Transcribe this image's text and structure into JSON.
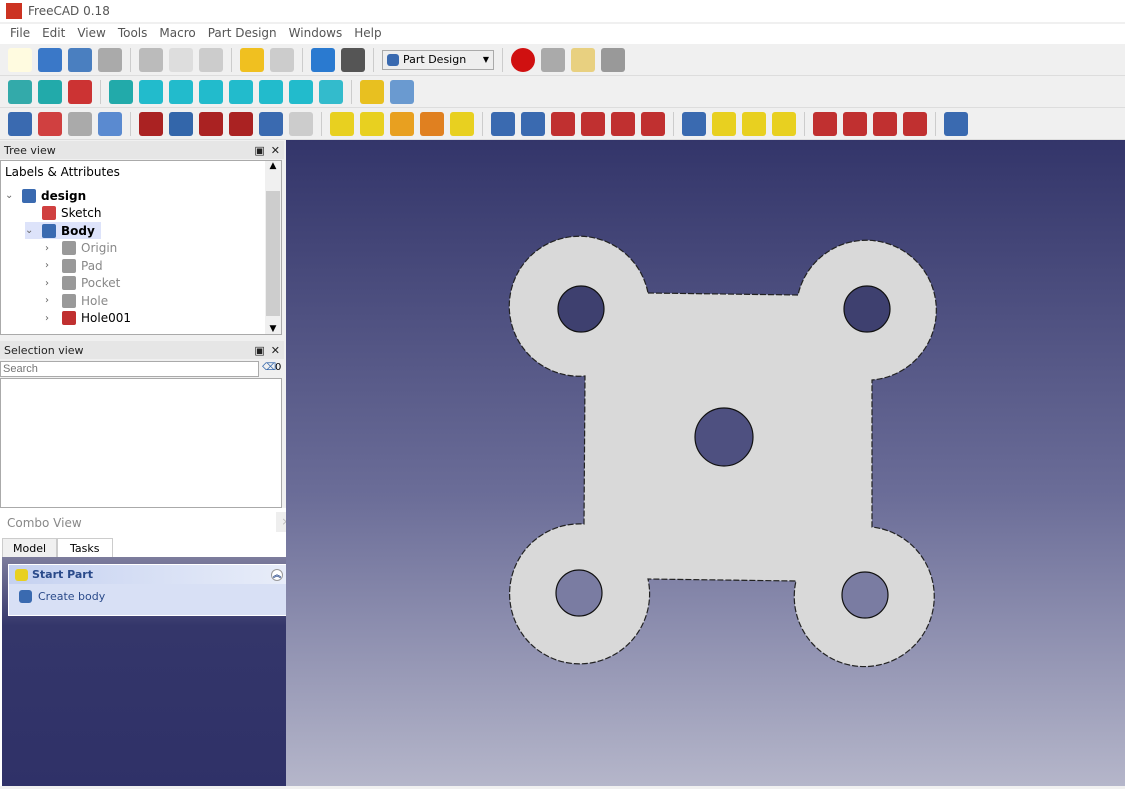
{
  "window": {
    "title": "FreeCAD 0.18",
    "logo": "Fc"
  },
  "menu": [
    "File",
    "Edit",
    "View",
    "Tools",
    "Macro",
    "Part Design",
    "Windows",
    "Help"
  ],
  "toolbar1": {
    "icons": [
      [
        "new-file-icon",
        "#fffbe0"
      ],
      [
        "open-icon",
        "#3a78c8"
      ],
      [
        "save-icon",
        "#4a7fc0"
      ],
      [
        "save-as-icon",
        "#aaa"
      ],
      "|",
      [
        "cut-icon",
        "#bbb"
      ],
      [
        "copy-icon",
        "#ddd"
      ],
      [
        "paste-icon",
        "#ccc"
      ],
      "|",
      [
        "undo-icon",
        "#f0c020"
      ],
      [
        "redo-icon",
        "#ccc"
      ],
      "|",
      [
        "refresh-icon",
        "#2a7ad0"
      ],
      [
        "whats-this-icon",
        "#555"
      ]
    ],
    "workbench": "Part Design",
    "macro_icons": [
      [
        "record-macro-icon",
        "#d01010"
      ],
      [
        "stop-macro-icon",
        "#aaa"
      ],
      [
        "edit-macro-icon",
        "#e8d080"
      ],
      [
        "run-macro-icon",
        "#999"
      ]
    ]
  },
  "toolbar2": {
    "icons": [
      [
        "fit-all-icon",
        "#3aa"
      ],
      [
        "fit-selection-icon",
        "#2aa"
      ],
      [
        "draw-style-icon",
        "#c33"
      ],
      "|",
      [
        "isometric-view-icon",
        "#2aa"
      ],
      [
        "front-view-icon",
        "#2bc"
      ],
      [
        "top-view-icon",
        "#2bc"
      ],
      [
        "right-view-icon",
        "#2bc"
      ],
      [
        "rear-view-icon",
        "#2bc"
      ],
      [
        "bottom-view-icon",
        "#2bc"
      ],
      [
        "left-view-icon",
        "#2bc"
      ],
      [
        "measure-icon",
        "#3bc"
      ],
      "|",
      [
        "create-part-icon",
        "#e8c020"
      ],
      [
        "create-group-icon",
        "#6a9ad0"
      ]
    ]
  },
  "toolbar3": {
    "icons": [
      [
        "body-icon",
        "#3a6ab0"
      ],
      [
        "sketch-icon",
        "#d04040"
      ],
      [
        "shape-binder-icon",
        "#aaa"
      ],
      [
        "clone-icon",
        "#5a8ad0"
      ],
      "|",
      [
        "datum-point-icon",
        "#a22"
      ],
      [
        "datum-line-icon",
        "#36a"
      ],
      [
        "datum-plane-icon",
        "#a22"
      ],
      [
        "local-cs-icon",
        "#a22"
      ],
      [
        "sub-shape-binder-icon",
        "#3a6ab0"
      ],
      [
        "clone2-icon",
        "#ccc"
      ],
      "|",
      [
        "pad-icon",
        "#e8d020"
      ],
      [
        "revolution-icon",
        "#e8d020"
      ],
      [
        "additive-loft-icon",
        "#e8a020"
      ],
      [
        "additive-pipe-icon",
        "#e08020"
      ],
      [
        "additive-primitive-icon",
        "#e8d020"
      ],
      "|",
      [
        "pocket-icon",
        "#3a6ab0"
      ],
      [
        "hole-icon",
        "#3a6ab0"
      ],
      [
        "groove-icon",
        "#c03030"
      ],
      [
        "subtractive-loft-icon",
        "#c03030"
      ],
      [
        "subtractive-pipe-icon",
        "#c03030"
      ],
      [
        "subtractive-primitive-icon",
        "#c03030"
      ],
      "|",
      [
        "mirrored-icon",
        "#3a6ab0"
      ],
      [
        "linear-pattern-icon",
        "#e8d020"
      ],
      [
        "polar-pattern-icon",
        "#e8d020"
      ],
      [
        "multi-transform-icon",
        "#e8d020"
      ],
      "|",
      [
        "fillet-icon",
        "#c03030"
      ],
      [
        "chamfer-icon",
        "#c03030"
      ],
      [
        "draft-icon",
        "#c03030"
      ],
      [
        "thickness-icon",
        "#c03030"
      ],
      "|",
      [
        "boolean-icon",
        "#3a6ab0"
      ]
    ]
  },
  "tree_view": {
    "title": "Tree view",
    "header": "Labels & Attributes",
    "items": [
      {
        "label": "design",
        "icon": "part-icon",
        "color": "#3a6ab0",
        "level": 0,
        "expand": "open",
        "bold": true
      },
      {
        "label": "Sketch",
        "icon": "sketch-icon",
        "color": "#d04040",
        "level": 1,
        "expand": "",
        "bold": false
      },
      {
        "label": "Body",
        "icon": "body-icon",
        "color": "#3a6ab0",
        "level": 1,
        "expand": "open",
        "bold": true,
        "selected": true
      },
      {
        "label": "Origin",
        "icon": "origin-icon",
        "color": "#999",
        "level": 2,
        "expand": "closed",
        "dim": true
      },
      {
        "label": "Pad",
        "icon": "pad-icon",
        "color": "#999",
        "level": 2,
        "expand": "closed",
        "dim": true
      },
      {
        "label": "Pocket",
        "icon": "pocket-icon",
        "color": "#999",
        "level": 2,
        "expand": "closed",
        "dim": true
      },
      {
        "label": "Hole",
        "icon": "hole-icon",
        "color": "#999",
        "level": 2,
        "expand": "closed",
        "dim": true
      },
      {
        "label": "Hole001",
        "icon": "hole-icon",
        "color": "#c03030",
        "level": 2,
        "expand": "closed"
      }
    ]
  },
  "selection_view": {
    "title": "Selection view",
    "search_placeholder": "Search",
    "count": "0"
  },
  "combo_view": {
    "title": "Combo View",
    "close": "×",
    "tabs": [
      "Model",
      "Tasks"
    ],
    "active_tab": "Tasks",
    "task_panel": {
      "title": "Start Part",
      "action": "Create body"
    }
  }
}
